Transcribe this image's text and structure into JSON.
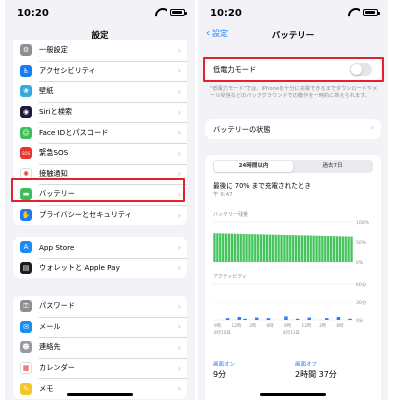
{
  "left": {
    "time": "10:20",
    "title": "設定",
    "group1": [
      {
        "label": "一般設定",
        "icon": "gear-icon",
        "color": "#8e8e93",
        "glyph": "⚙"
      },
      {
        "label": "アクセシビリティ",
        "icon": "accessibility-icon",
        "color": "#1a7cf2",
        "glyph": "♿"
      },
      {
        "label": "壁紙",
        "icon": "wallpaper-icon",
        "color": "#35aadc",
        "glyph": "❀"
      },
      {
        "label": "Siriと検索",
        "icon": "siri-icon",
        "color": "#1c1c3a",
        "glyph": "◉"
      },
      {
        "label": "Face IDとパスコード",
        "icon": "faceid-icon",
        "color": "#3cbf5a",
        "glyph": "☺"
      },
      {
        "label": "緊急SOS",
        "icon": "sos-icon",
        "color": "#e8362f",
        "glyph": "SOS"
      },
      {
        "label": "接触通知",
        "icon": "exposure-icon",
        "color": "#ffffff",
        "glyph": "✺"
      },
      {
        "label": "バッテリー",
        "icon": "battery-icon",
        "color": "#3cbf5a",
        "glyph": "▬"
      },
      {
        "label": "プライバシーとセキュリティ",
        "icon": "privacy-hand-icon",
        "color": "#1a7cf2",
        "glyph": "✋"
      }
    ],
    "group2": [
      {
        "label": "App Store",
        "icon": "appstore-icon",
        "color": "#1a8cf7",
        "glyph": "A"
      },
      {
        "label": "ウォレットと Apple Pay",
        "icon": "wallet-icon",
        "color": "#1c1c1e",
        "glyph": "▤"
      }
    ],
    "group3": [
      {
        "label": "パスワード",
        "icon": "key-icon",
        "color": "#8e8e93",
        "glyph": "⚿"
      },
      {
        "label": "メール",
        "icon": "mail-icon",
        "color": "#1a8cf7",
        "glyph": "✉"
      },
      {
        "label": "連絡先",
        "icon": "contacts-icon",
        "color": "#9a9aa0",
        "glyph": "☻"
      },
      {
        "label": "カレンダー",
        "icon": "calendar-icon",
        "color": "#ffffff",
        "glyph": "▦"
      },
      {
        "label": "メモ",
        "icon": "notes-icon",
        "color": "#f5c626",
        "glyph": "✎"
      }
    ]
  },
  "right": {
    "time": "10:20",
    "back": "設定",
    "title": "バッテリー",
    "low_power_label": "低電力モード",
    "low_power_on": false,
    "low_power_desc": "\"低電力モード\"では、iPhoneを十分に充電できるまでダウンロードやメール受信などのバックグラウンドでの動作を一時的に抑えられます。",
    "health_label": "バッテリーの状態",
    "tabs": [
      "24時間以内",
      "過去7日"
    ],
    "active_tab": 0,
    "last_charged": "最後に 70% まで充電されたとき",
    "last_charged_time": "午 9:47",
    "level_label": "バッテリー残量",
    "level_ticks": [
      "100%",
      "50%",
      "0%"
    ],
    "activity_label": "アクティビティ",
    "activity_ticks": [
      "60分",
      "30分",
      "0分"
    ],
    "time_labels": [
      "9時",
      "12時",
      "3時",
      "6時",
      "9時",
      "12時",
      "3時",
      "6時"
    ],
    "date_labels": [
      "8月10日",
      "8月11日"
    ],
    "screen_on_label": "画面オン",
    "screen_on_value": "9分",
    "screen_off_label": "画面オフ",
    "screen_off_value": "2時間 37分",
    "colors": {
      "accent": "#2a7df6",
      "battery_green": "#44c45c",
      "activity": "#2a7df6",
      "highlight": "#e0232c"
    }
  }
}
